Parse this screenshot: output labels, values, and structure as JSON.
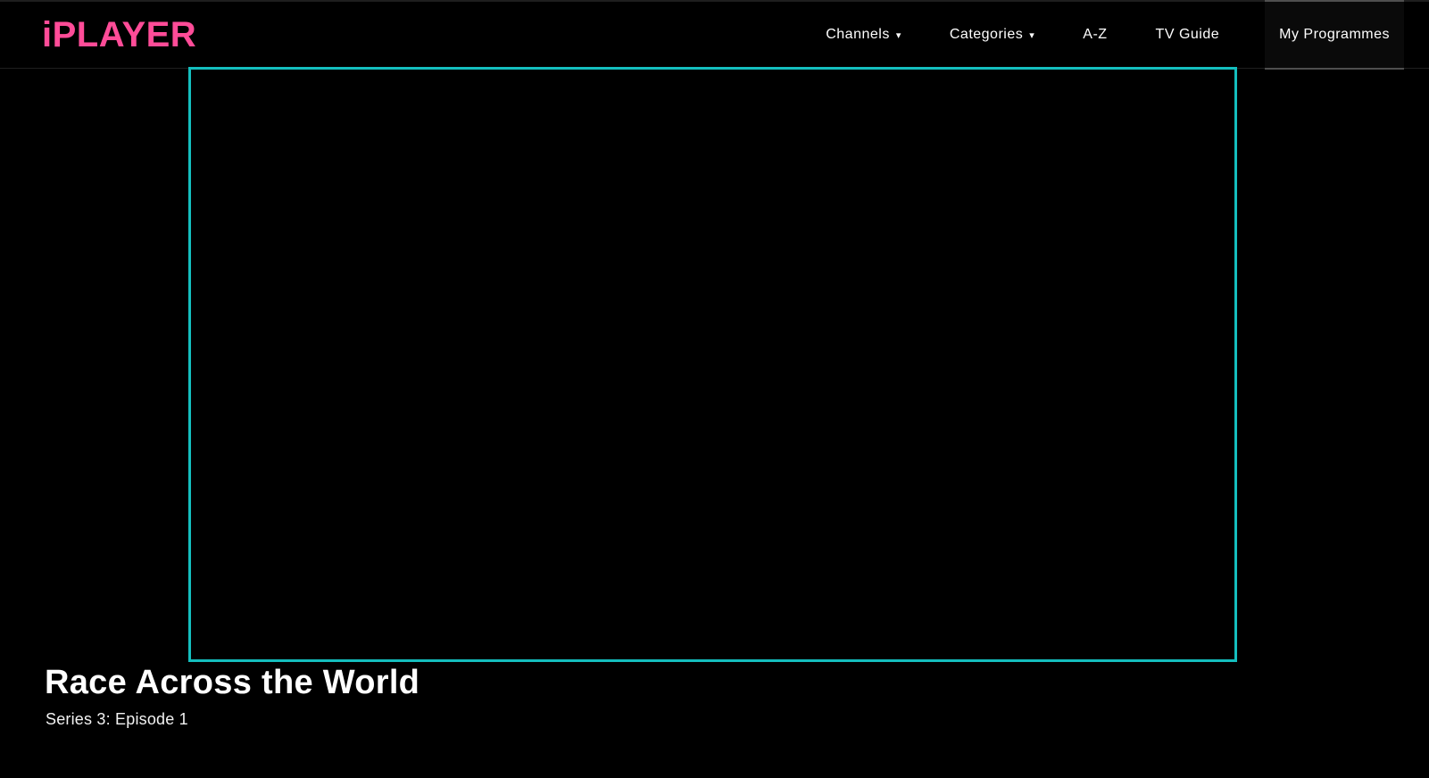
{
  "header": {
    "logo": "iPLAYER",
    "nav": [
      {
        "label": "Channels",
        "has_dropdown": true,
        "active": false
      },
      {
        "label": "Categories",
        "has_dropdown": true,
        "active": false
      },
      {
        "label": "A-Z",
        "has_dropdown": false,
        "active": false
      },
      {
        "label": "TV Guide",
        "has_dropdown": false,
        "active": false
      },
      {
        "label": "My Programmes",
        "has_dropdown": false,
        "active": true
      }
    ]
  },
  "player": {
    "state": "black-video-surface-focused"
  },
  "programme": {
    "title": "Race Across the World",
    "subtitle": "Series 3: Episode 1"
  },
  "icons": {
    "chevron_down": "▾"
  },
  "colors": {
    "background": "#000000",
    "brand_pink": "#ff4c98",
    "focus_teal": "#14bebe",
    "nav_text": "#ffffff",
    "header_border": "#1e1e1e",
    "active_nav_border": "#4f4f4f"
  }
}
